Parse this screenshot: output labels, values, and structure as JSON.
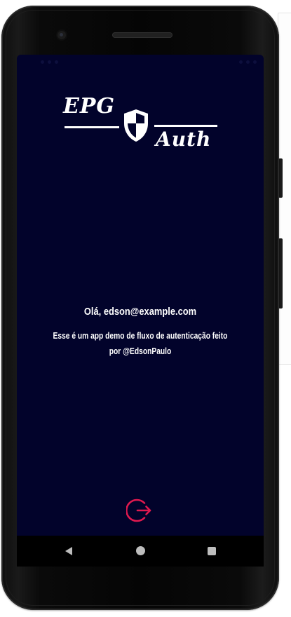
{
  "logo": {
    "top_text": "EPG",
    "bottom_text": "Auth"
  },
  "greeting": "Olá, edson@example.com",
  "description": "Esse é um app demo de fluxo de autenticação feito por @EdsonPaulo",
  "logout": {
    "icon": "logout-icon"
  },
  "navigation": {
    "back_icon": "back-triangle-icon",
    "home_icon": "home-circle-icon",
    "recents_icon": "recents-square-icon"
  },
  "colors": {
    "screen_background": "#02032b",
    "text": "#ffffff",
    "accent": "#e0194f",
    "nav_bar": "#000000",
    "nav_icons": "#bdbdbd"
  }
}
